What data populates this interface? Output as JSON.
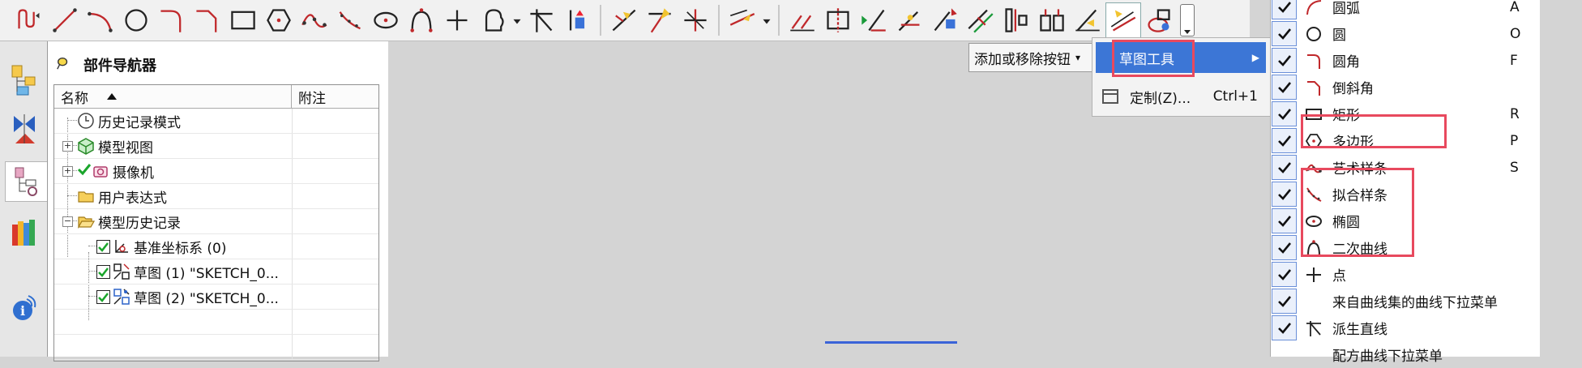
{
  "toolbar": {
    "icons": [
      "profile-icon",
      "line-icon",
      "arc-icon",
      "circle-icon",
      "fillet-icon",
      "chamfer-icon",
      "rectangle-icon",
      "polygon-icon",
      "studio-spline-icon",
      "fit-spline-icon",
      "ellipse-icon",
      "conic-icon",
      "point-icon",
      "curve-set-icon",
      "trim-recipe-icon",
      "derived-line-icon",
      "quick-trim-icon",
      "quick-extend-icon",
      "make-corner-icon",
      "offset-curve-icon",
      "pattern-curve-icon",
      "mirror-curve-icon",
      "intersection-icon",
      "project-curve-icon",
      "constraint-icon",
      "dimension-icon",
      "relation-icon",
      "display-icon",
      "convert-reference-icon",
      "alternate-solution-icon",
      "inferred-constraint-icon",
      "continuous-constraint-icon"
    ]
  },
  "navigator": {
    "title": "部件导航器",
    "columns": {
      "name": "名称",
      "note": "附注"
    },
    "rows": [
      {
        "label": "历史记录模式"
      },
      {
        "label": "模型视图"
      },
      {
        "label": "摄像机"
      },
      {
        "label": "用户表达式"
      },
      {
        "label": "模型历史记录"
      },
      {
        "label": "基准坐标系 (0)"
      },
      {
        "label": "草图 (1) \"SKETCH_0..."
      },
      {
        "label": "草图 (2) \"SKETCH_0..."
      }
    ]
  },
  "popup": {
    "add_remove": "添加或移除按钮",
    "sketch_tool": "草图工具",
    "customize": "定制(Z)...",
    "customize_shortcut": "Ctrl+1"
  },
  "menu": {
    "items": [
      {
        "label": "圆弧",
        "key": "A",
        "icon": "arc-icon",
        "checked": true
      },
      {
        "label": "圆",
        "key": "O",
        "icon": "circle-icon",
        "checked": true
      },
      {
        "label": "圆角",
        "key": "F",
        "icon": "fillet-icon",
        "checked": true
      },
      {
        "label": "倒斜角",
        "key": "",
        "icon": "chamfer-icon",
        "checked": true
      },
      {
        "label": "矩形",
        "key": "R",
        "icon": "rectangle-icon",
        "checked": true
      },
      {
        "label": "多边形",
        "key": "P",
        "icon": "polygon-icon",
        "checked": true
      },
      {
        "label": "艺术样条",
        "key": "S",
        "icon": "studio-spline-icon",
        "checked": true
      },
      {
        "label": "拟合样条",
        "key": "",
        "icon": "fit-spline-icon",
        "checked": true
      },
      {
        "label": "椭圆",
        "key": "",
        "icon": "ellipse-icon",
        "checked": true
      },
      {
        "label": "二次曲线",
        "key": "",
        "icon": "conic-icon",
        "checked": true
      },
      {
        "label": "点",
        "key": "",
        "icon": "point-icon",
        "checked": true
      },
      {
        "label": "来自曲线集的曲线下拉菜单",
        "key": "",
        "icon": "",
        "checked": true
      },
      {
        "label": "派生直线",
        "key": "",
        "icon": "derived-line-icon",
        "checked": true
      },
      {
        "label": "配方曲线下拉菜单",
        "key": "",
        "icon": "",
        "checked": false
      }
    ]
  },
  "colors": {
    "highlight": "#e8495e",
    "selection": "#3c76d6",
    "sketch_red": "#c0282b"
  }
}
